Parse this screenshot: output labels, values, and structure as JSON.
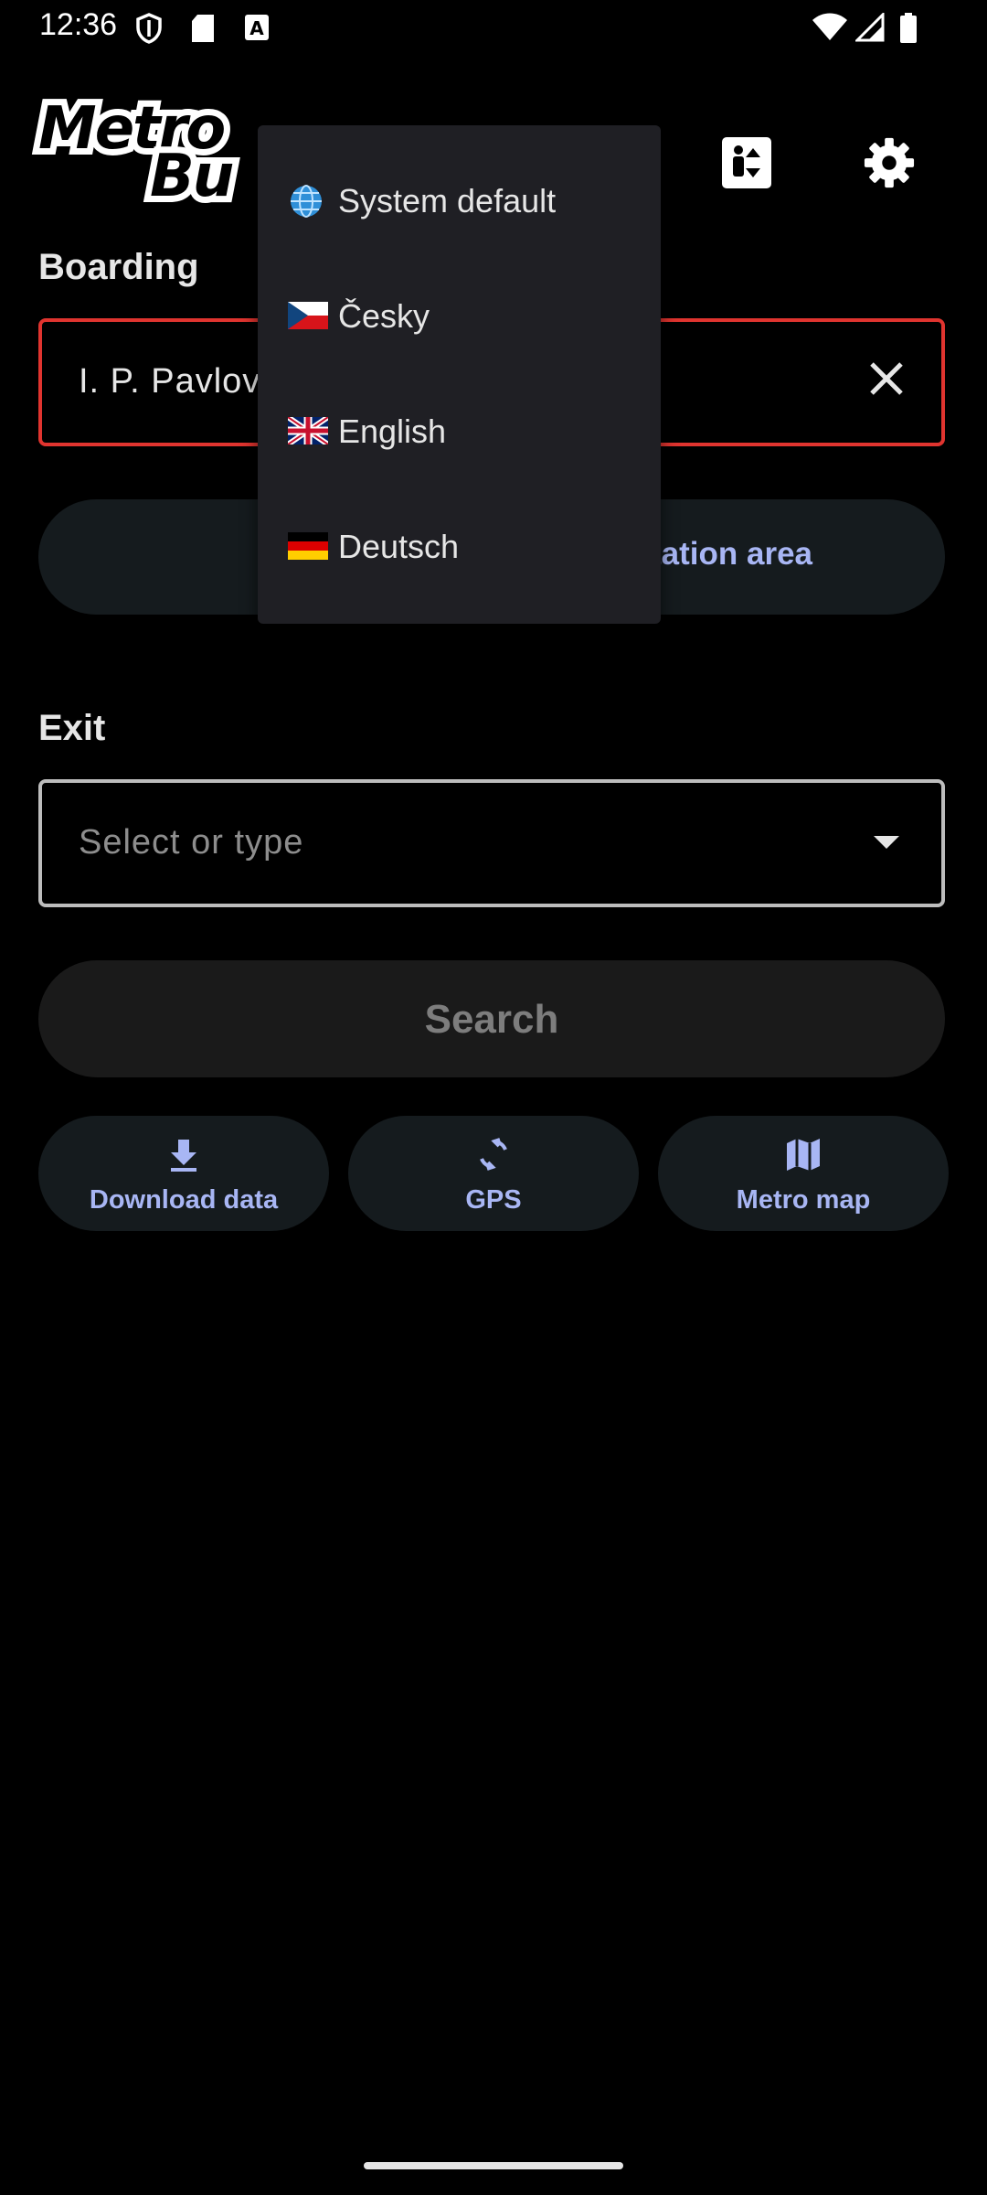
{
  "status_bar": {
    "time": "12:36"
  },
  "app": {
    "logo_line1": "Metro",
    "logo_line2": "Bu"
  },
  "boarding": {
    "label": "Boarding",
    "value": "I. P. Pavlov"
  },
  "swap_row": {
    "label": "tation area"
  },
  "exit": {
    "label": "Exit",
    "placeholder": "Select or type"
  },
  "search": {
    "label": "Search"
  },
  "actions": [
    {
      "label": "Download data",
      "icon": "download-icon"
    },
    {
      "label": "GPS",
      "icon": "refresh-icon"
    },
    {
      "label": "Metro map",
      "icon": "map-icon"
    }
  ],
  "language_menu": {
    "items": [
      {
        "label": "System default",
        "icon": "globe-icon"
      },
      {
        "label": "Česky",
        "icon": "czech-flag-icon"
      },
      {
        "label": "English",
        "icon": "uk-flag-icon"
      },
      {
        "label": "Deutsch",
        "icon": "german-flag-icon"
      }
    ]
  },
  "colors": {
    "accent": "#a8b6f4",
    "error": "#e0342f",
    "button_bg": "#151b1e",
    "menu_bg": "#1f1f24"
  }
}
